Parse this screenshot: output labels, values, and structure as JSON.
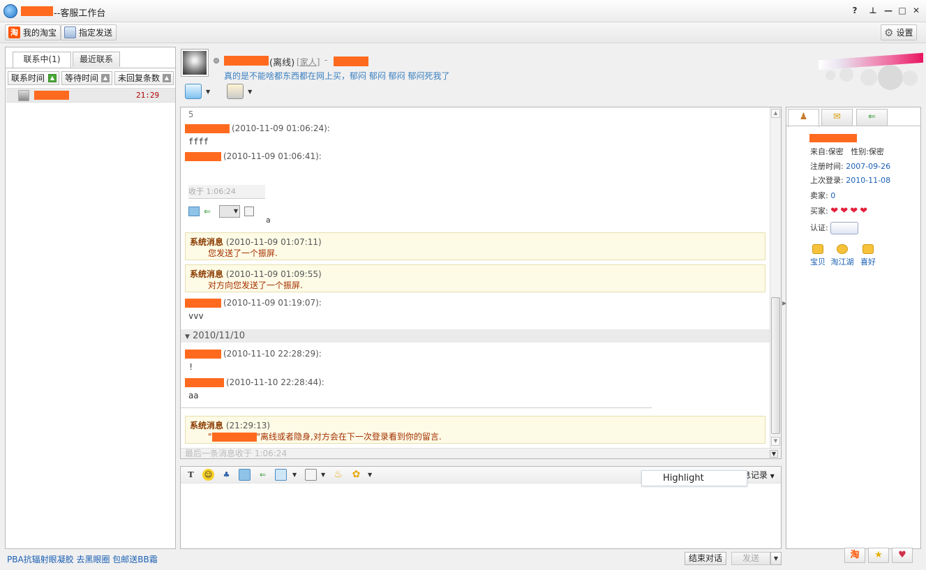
{
  "window": {
    "title": "--客服工作台",
    "controls": [
      "?",
      "pin",
      "minimize",
      "maximize",
      "close"
    ]
  },
  "toolbar": {
    "my_taobao": "我的淘宝",
    "designated_send": "指定发送",
    "settings": "设置"
  },
  "left": {
    "tabs": [
      {
        "label": "联系中(1)",
        "active": true
      },
      {
        "label": "最近联系",
        "active": false
      }
    ],
    "sort_buttons": [
      "联系时间",
      "等待时间",
      "未回复条数"
    ],
    "contacts": [
      {
        "time": "21:29"
      }
    ],
    "ad_link": "PBA抗辐射眼凝胶 去黑眼圈 包邮送BB霜"
  },
  "chat_header": {
    "status": "(离线)",
    "group": "家人",
    "dash": "-",
    "signature": "真的是不能啥都东西都在网上买，郁闷 郁闷 郁闷 郁闷死我了"
  },
  "chat": {
    "top_fragment": "5",
    "messages": [
      {
        "time": "(2010-11-09 01:06:24):",
        "body": "ffff"
      },
      {
        "time": "(2010-11-09 01:06:41):",
        "body": ""
      }
    ],
    "embedded_strip": {
      "time": "收于 1:06:24",
      "suffix": "a"
    },
    "system_messages": [
      {
        "label": "系统消息",
        "time": "(2010-11-09 01:07:11)",
        "text": "您发送了一个振屏."
      },
      {
        "label": "系统消息",
        "time": "(2010-11-09 01:09:55)",
        "text": "对方向您发送了一个振屏."
      }
    ],
    "message_3": {
      "time": "(2010-11-09 01:19:07):",
      "body": "vvv"
    },
    "date_divider": "2010/11/10",
    "messages_day2": [
      {
        "time": "(2010-11-10 22:28:29):",
        "body": "!"
      },
      {
        "time": "(2010-11-10 22:28:44):",
        "body": "aa"
      }
    ],
    "offline_notice": {
      "label": "系统消息",
      "time": "(21:29:13)",
      "quote_open": "\"",
      "text": "\"离线或者隐身,对方会在下一次登录看到你的留言."
    },
    "footer": "最后一条消息收于 1:06:24"
  },
  "input": {
    "history_label": "消息记录",
    "highlight_popup": "Highlight"
  },
  "bottom": {
    "end_chat": "结束对话",
    "send": "发送"
  },
  "right_panel": {
    "from_label": "来自:保密",
    "gender_label": "性别:保密",
    "registered_label": "注册时间:",
    "registered_value": "2007-09-26",
    "last_login_label": "上次登录:",
    "last_login_value": "2010-11-08",
    "seller_label": "卖家:",
    "seller_value": "0",
    "buyer_label": "买家:",
    "buyer_hearts": 4,
    "cert_label": "认证:",
    "quick_links": [
      "宝贝",
      "淘江湖",
      "喜好"
    ]
  },
  "colors": {
    "redaction": "#ff6a1f",
    "link": "#1a5fb4",
    "system_text": "#a43000",
    "system_bg": "#fdfbe6"
  }
}
